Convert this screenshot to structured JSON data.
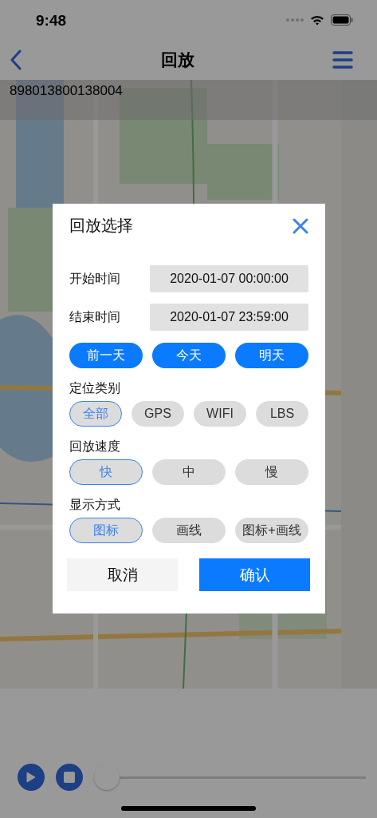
{
  "status_bar": {
    "time": "9:48"
  },
  "nav": {
    "title": "回放"
  },
  "device_id": "898013800138004",
  "dialog": {
    "title": "回放选择",
    "fields": [
      {
        "label": "开始时间",
        "value": "2020-01-07 00:00:00"
      },
      {
        "label": "结束时间",
        "value": "2020-01-07 23:59:00"
      }
    ],
    "day_buttons": [
      "前一天",
      "今天",
      "明天"
    ],
    "groups": [
      {
        "label": "定位类别",
        "options": [
          {
            "label": "全部",
            "selected": true
          },
          {
            "label": "GPS",
            "selected": false
          },
          {
            "label": "WIFI",
            "selected": false
          },
          {
            "label": "LBS",
            "selected": false
          }
        ]
      },
      {
        "label": "回放速度",
        "options": [
          {
            "label": "快",
            "selected": true
          },
          {
            "label": "中",
            "selected": false
          },
          {
            "label": "慢",
            "selected": false
          }
        ]
      },
      {
        "label": "显示方式",
        "options": [
          {
            "label": "图标",
            "selected": true
          },
          {
            "label": "画线",
            "selected": false
          },
          {
            "label": "图标+画线",
            "selected": false
          }
        ]
      }
    ],
    "cancel": "取消",
    "confirm": "确认"
  },
  "player": {
    "level": 0
  }
}
